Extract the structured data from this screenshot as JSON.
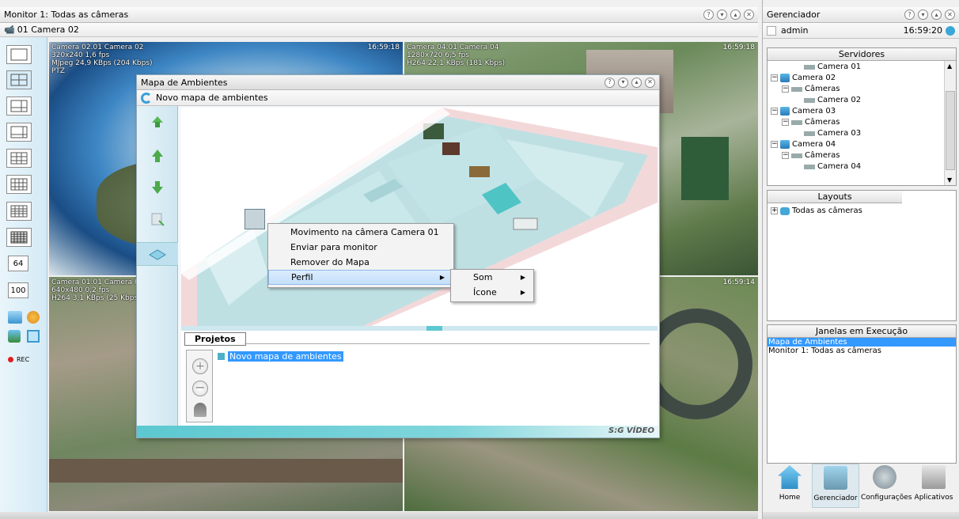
{
  "monitor": {
    "title": "Monitor 1: Todas as câmeras",
    "subtitle": "01 Camera 02"
  },
  "toolbar": {
    "btn_64": "64",
    "btn_100": "100",
    "rec": "REC"
  },
  "cameras": [
    {
      "info": "Camera 02.01 Camera 02\n320x240 1,6 fps\nMJpeg 24,9 KBps (204 Kbps)\nPTZ",
      "time": "16:59:18"
    },
    {
      "info": "Camera 04.01 Camera 04\n1280x720 6,5 fps\nH264 22,1 KBps (181 Kbps)",
      "time": "16:59:18"
    },
    {
      "info": "Camera 01.01 Camera 01\n640x480 0,2 fps\nH264 3,1 KBps (25 Kbps)",
      "time": ""
    },
    {
      "info": "",
      "time": "16:59:14"
    }
  ],
  "map_window": {
    "title": "Mapa de Ambientes",
    "subtitle": "Novo mapa de ambientes",
    "projects_label": "Projetos",
    "project_item": "Novo mapa de ambientes",
    "brand": "S:G VÍDEO"
  },
  "context_menu": {
    "items": [
      "Movimento na câmera Camera 01",
      "Enviar para monitor",
      "Remover do Mapa",
      "Perfil"
    ],
    "submenu": [
      "Som",
      "Ícone"
    ]
  },
  "manager": {
    "title": "Gerenciador",
    "user": "admin",
    "time": "16:59:20",
    "servers_label": "Servidores",
    "tree": [
      {
        "label": "Camera 01",
        "level": 3
      },
      {
        "label": "Camera 02",
        "level": 0
      },
      {
        "label": "Câmeras",
        "level": 1
      },
      {
        "label": "Camera 02",
        "level": 3
      },
      {
        "label": "Camera 03",
        "level": 0
      },
      {
        "label": "Câmeras",
        "level": 1
      },
      {
        "label": "Camera 03",
        "level": 3
      },
      {
        "label": "Camera 04",
        "level": 0
      },
      {
        "label": "Câmeras",
        "level": 1
      },
      {
        "label": "Camera 04",
        "level": 3
      }
    ],
    "layouts_label": "Layouts",
    "layout_item": "Todas as câmeras",
    "running_label": "Janelas em Execução",
    "running": [
      "Mapa de Ambientes",
      "Monitor 1: Todas as câmeras"
    ],
    "nav": [
      "Home",
      "Gerenciador",
      "Configurações",
      "Aplicativos"
    ],
    "brand": "S:G VÍDEO"
  },
  "colors": {
    "accent": "#3399ff",
    "panel_blue": "#d4eaf5",
    "teal_bar": "#5cc8d0"
  }
}
